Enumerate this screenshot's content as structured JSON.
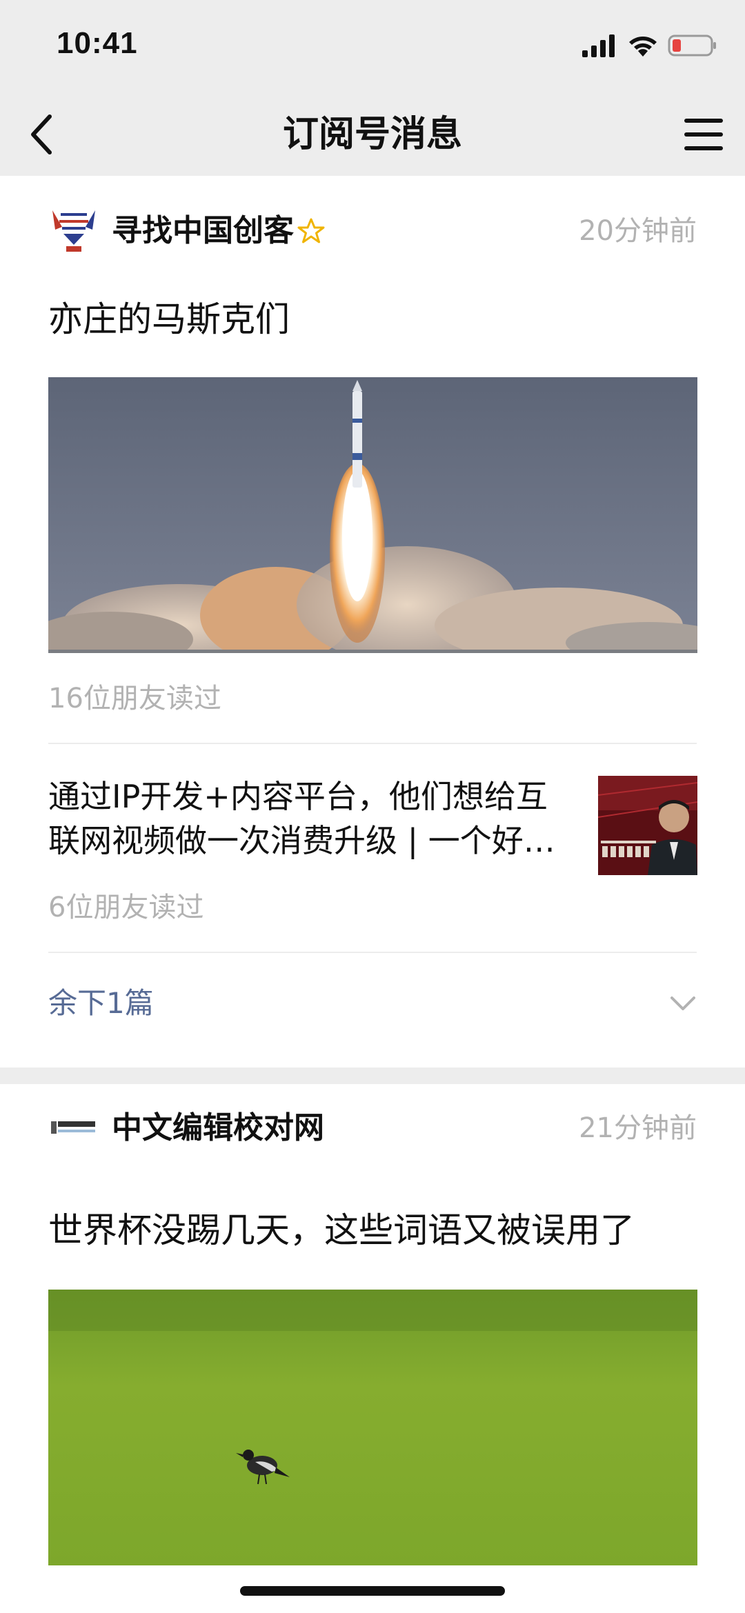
{
  "status_bar": {
    "time": "10:41"
  },
  "nav": {
    "title": "订阅号消息"
  },
  "messages": [
    {
      "account": "寻找中国创客",
      "time_ago": "20分钟前",
      "lead_title": "亦庄的马斯克们",
      "lead_readers": "16位朋友读过",
      "sub_title_line1": "通过IP开发+内容平台，他们想给互",
      "sub_title_line2": "联网视频做一次消费升级 | 一个好…",
      "sub_readers": "6位朋友读过",
      "more_label": "余下1篇"
    },
    {
      "account": "中文编辑校对网",
      "time_ago": "21分钟前",
      "lead_title": "世界杯没踢几天，这些词语又被误用了"
    }
  ],
  "colors": {
    "background": "#ededed",
    "card": "#ffffff",
    "link": "#576b95",
    "muted": "#b2b2b2",
    "star": "#f0b400",
    "battery_low": "#e64340"
  },
  "icons": [
    "back-arrow-icon",
    "menu-icon",
    "signal-icon",
    "wifi-icon",
    "battery-icon",
    "star-icon",
    "chevron-down-icon"
  ]
}
